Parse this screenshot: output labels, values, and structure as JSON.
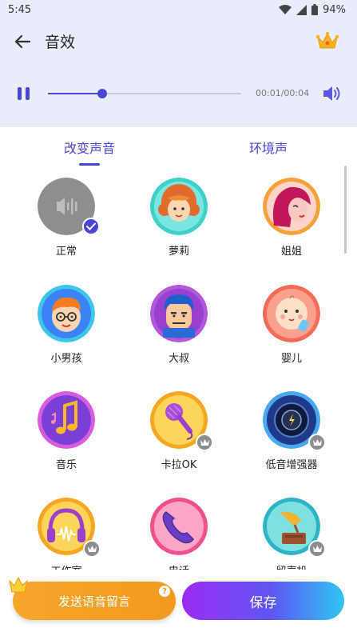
{
  "status_bar": {
    "time": "5:45",
    "battery": "94%"
  },
  "header": {
    "title": "音效",
    "icons": {
      "back": "back-arrow-icon",
      "vip": "crown-icon"
    }
  },
  "player": {
    "time": "00:01/00:04",
    "progress": 0.28,
    "state": "playing"
  },
  "tabs": [
    {
      "label": "改变声音",
      "selected": true
    },
    {
      "label": "环境声",
      "selected": false
    }
  ],
  "effects": [
    {
      "label": "正常",
      "selected": true,
      "vip": false
    },
    {
      "label": "萝莉",
      "selected": false,
      "vip": false
    },
    {
      "label": "姐姐",
      "selected": false,
      "vip": false
    },
    {
      "label": "小男孩",
      "selected": false,
      "vip": false
    },
    {
      "label": "大叔",
      "selected": false,
      "vip": false
    },
    {
      "label": "婴儿",
      "selected": false,
      "vip": false
    },
    {
      "label": "音乐",
      "selected": false,
      "vip": false
    },
    {
      "label": "卡拉OK",
      "selected": false,
      "vip": true
    },
    {
      "label": "低音增强器",
      "selected": false,
      "vip": true
    },
    {
      "label": "工作室",
      "selected": false,
      "vip": true
    },
    {
      "label": "电话",
      "selected": false,
      "vip": false
    },
    {
      "label": "留声机",
      "selected": false,
      "vip": true
    }
  ],
  "bottom": {
    "send_label": "发送语音留言",
    "help_label": "?",
    "save_label": "保存"
  },
  "colors": {
    "accent": "#4a47d8",
    "header_bg": "#e9edfb",
    "send": "#f29a1f"
  }
}
